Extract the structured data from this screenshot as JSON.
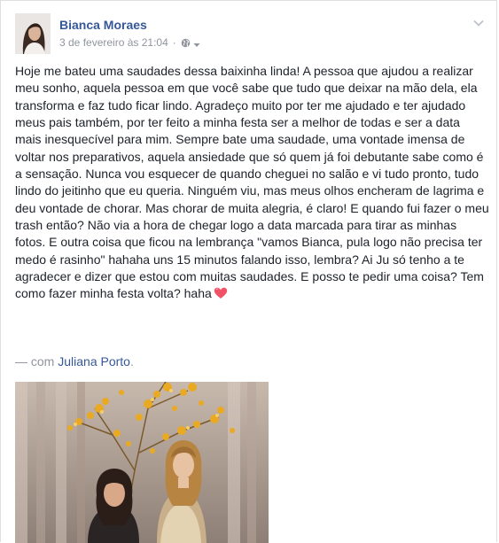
{
  "post": {
    "author": "Bianca Moraes",
    "timestamp": "3 de fevereiro às 21:04",
    "separator": "·",
    "privacy_icon": "globe-icon",
    "menu_icon": "chevron-down-icon",
    "text": "Hoje me bateu uma saudades dessa baixinha linda! A pessoa que ajudou a realizar meu sonho, aquela pessoa em que você sabe que tudo que deixar na mão dela, ela transforma e faz tudo ficar lindo. Agradeço muito por ter me ajudado e ter ajudado meus pais também, por ter feito a minha festa ser a melhor de todas e ser a data mais inesquecível para mim. Sempre bate uma saudade, uma vontade imensa de voltar nos preparativos, aquela ansiedade que só quem já foi debutante sabe como é a sensação. Nunca vou esquecer de quando cheguei no salão e vi tudo pronto, tudo lindo do jeitinho que eu queria. Ninguém viu, mas meus olhos encheram de lagrima e deu vontade de chorar. Mas chorar de muita alegria, é claro! E quando fui fazer o meu trash então? Não via a hora de chegar logo a data marcada para tirar as minhas fotos. E outra coisa que ficou na lembrança \"vamos Bianca, pula logo não precisa ter medo é rasinho\" hahaha uns 15 minutos falando isso, lembra? Ai Ju só tenho a te agradecer e dizer que estou com muitas saudades. E posso te pedir uma coisa? Tem como fazer minha festa volta? haha",
    "emoji": "heart-emoji",
    "with_prefix": "— com",
    "tagged_person": "Juliana Porto",
    "tag_suffix": "."
  },
  "colors": {
    "link": "#365899",
    "meta": "#90949c",
    "text": "#1d2129",
    "heart": "#f25268"
  }
}
